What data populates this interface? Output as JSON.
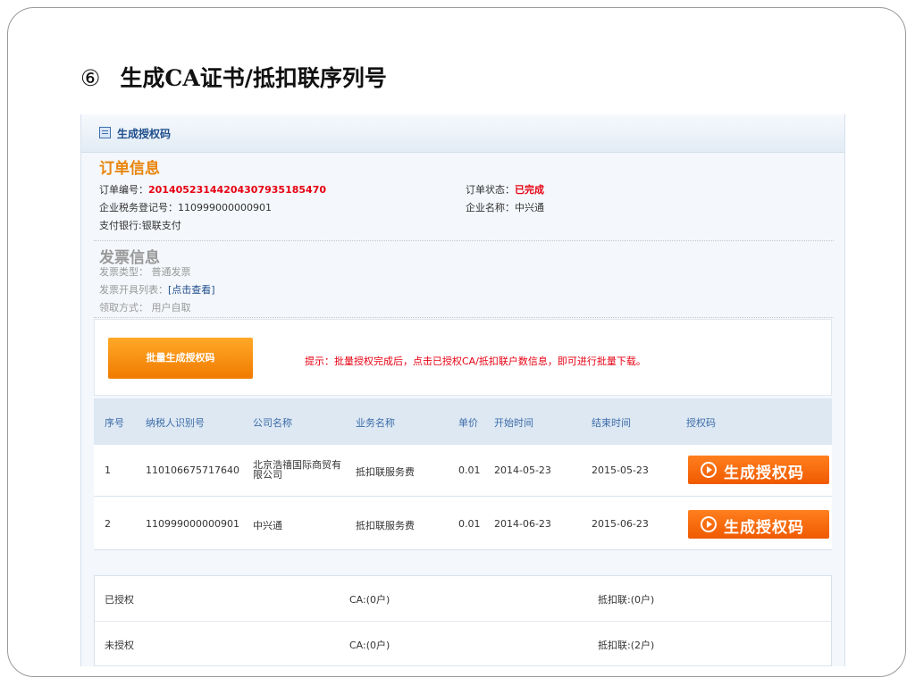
{
  "slide": {
    "step_number": "⑥",
    "title": "生成CA证书/抵扣联序列号"
  },
  "panel": {
    "title": "生成授权码",
    "icon": "list-icon"
  },
  "order": {
    "section_title": "订单信息",
    "number_label": "订单编号：",
    "number_value": "20140523144204307935185470",
    "tax_reg_label": "企业税务登记号：",
    "tax_reg_value": "110999000000901",
    "bank_text": "支付银行:银联支付",
    "status_label": "订单状态：",
    "status_value": "已完成",
    "company_label": "企业名称：",
    "company_value": "中兴通"
  },
  "invoice": {
    "section_title": "发票信息",
    "type_text": "发票类型： 普通发票",
    "list_label": "发票开具列表：",
    "list_link": "[点击查看]",
    "pickup_text": "领取方式： 用户自取"
  },
  "batch": {
    "button_label": "批量生成授权码",
    "hint": "提示：批量授权完成后，点击已授权CA/抵扣联户数信息，即可进行批量下载。"
  },
  "table": {
    "headers": [
      "序号",
      "纳税人识别号",
      "公司名称",
      "业务名称",
      "单价",
      "开始时间",
      "结束时间",
      "授权码"
    ],
    "rows": [
      {
        "index": "1",
        "taxpayer_id": "110106675717640",
        "company": "北京浩禧国际商贸有限公司",
        "service": "抵扣联服务费",
        "price": "0.01",
        "start": "2014-05-23",
        "end": "2015-05-23",
        "action": "生成授权码"
      },
      {
        "index": "2",
        "taxpayer_id": "110999000000901",
        "company": "中兴通",
        "service": "抵扣联服务费",
        "price": "0.01",
        "start": "2014-06-23",
        "end": "2015-06-23",
        "action": "生成授权码"
      }
    ]
  },
  "summary": {
    "authorized_label": "已授权",
    "authorized_ca": "CA:(0户)",
    "authorized_deduction": "抵扣联:(0户)",
    "unauthorized_label": "未授权",
    "unauthorized_ca": "CA:(0户)",
    "unauthorized_deduction": "抵扣联:(2户)"
  },
  "colors": {
    "accent_orange": "#f07b00",
    "title_orange": "#e8850c",
    "alert_red": "#e60012",
    "header_blue": "#1f4e8c",
    "table_head_bg": "#dde8f3"
  }
}
